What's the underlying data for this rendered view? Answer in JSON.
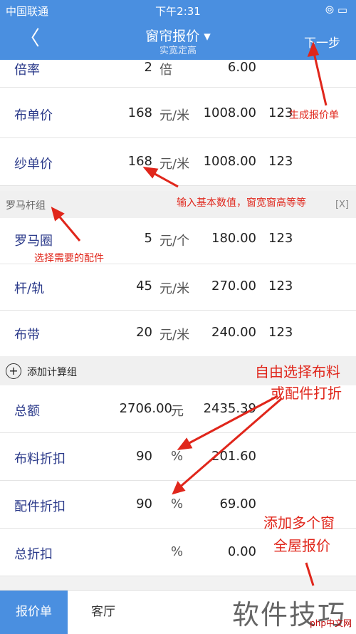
{
  "status_bar": {
    "carrier": "中国联通",
    "time": "下午2:31",
    "right": "⦾ ▭"
  },
  "nav": {
    "back": "〈",
    "title": "窗帘报价 ▾",
    "subtitle": "实宽定高",
    "next": "下一步"
  },
  "rows_top": [
    {
      "label": "倍率",
      "qty": "2",
      "unit": "倍",
      "amount": "6.00",
      "extra": ""
    },
    {
      "label": "布单价",
      "qty": "168",
      "unit": "元/米",
      "amount": "1008.00",
      "extra": "123"
    },
    {
      "label": "纱单价",
      "qty": "168",
      "unit": "元/米",
      "amount": "1008.00",
      "extra": "123"
    }
  ],
  "group": {
    "name": "罗马杆组",
    "close": "[X]"
  },
  "rows_group": [
    {
      "label": "罗马圈",
      "qty": "5",
      "unit": "元/个",
      "amount": "180.00",
      "extra": "123"
    },
    {
      "label": "杆/轨",
      "qty": "45",
      "unit": "元/米",
      "amount": "270.00",
      "extra": "123"
    },
    {
      "label": "布带",
      "qty": "20",
      "unit": "元/米",
      "amount": "240.00",
      "extra": "123"
    }
  ],
  "add_group": {
    "icon": "+",
    "label": "添加计算组"
  },
  "totals": [
    {
      "label": "总额",
      "qty": "2706.00",
      "unit": "元",
      "amount": "2435.39"
    },
    {
      "label": "布料折扣",
      "qty": "90",
      "unit": "%",
      "amount": "201.60"
    },
    {
      "label": "配件折扣",
      "qty": "90",
      "unit": "%",
      "amount": "69.00"
    },
    {
      "label": "总折扣",
      "qty": "",
      "unit": "%",
      "amount": "0.00"
    }
  ],
  "tabs": [
    {
      "label": "报价单"
    },
    {
      "label": "客厅"
    }
  ],
  "annotations": {
    "generate": "生成报价单",
    "input": "输入基本数值，窗宽窗高等等",
    "select": "选择需要的配件",
    "discount_1": "自由选择布料",
    "discount_2": "或配件打折",
    "multi_1": "添加多个窗",
    "multi_2": "全屋报价"
  },
  "watermark": {
    "text": "软件技巧",
    "site": "php中文网"
  },
  "colors": {
    "nav_bg": "#4a8fe0",
    "accent_text": "#2b3a8a",
    "annotation": "#e0261b"
  }
}
